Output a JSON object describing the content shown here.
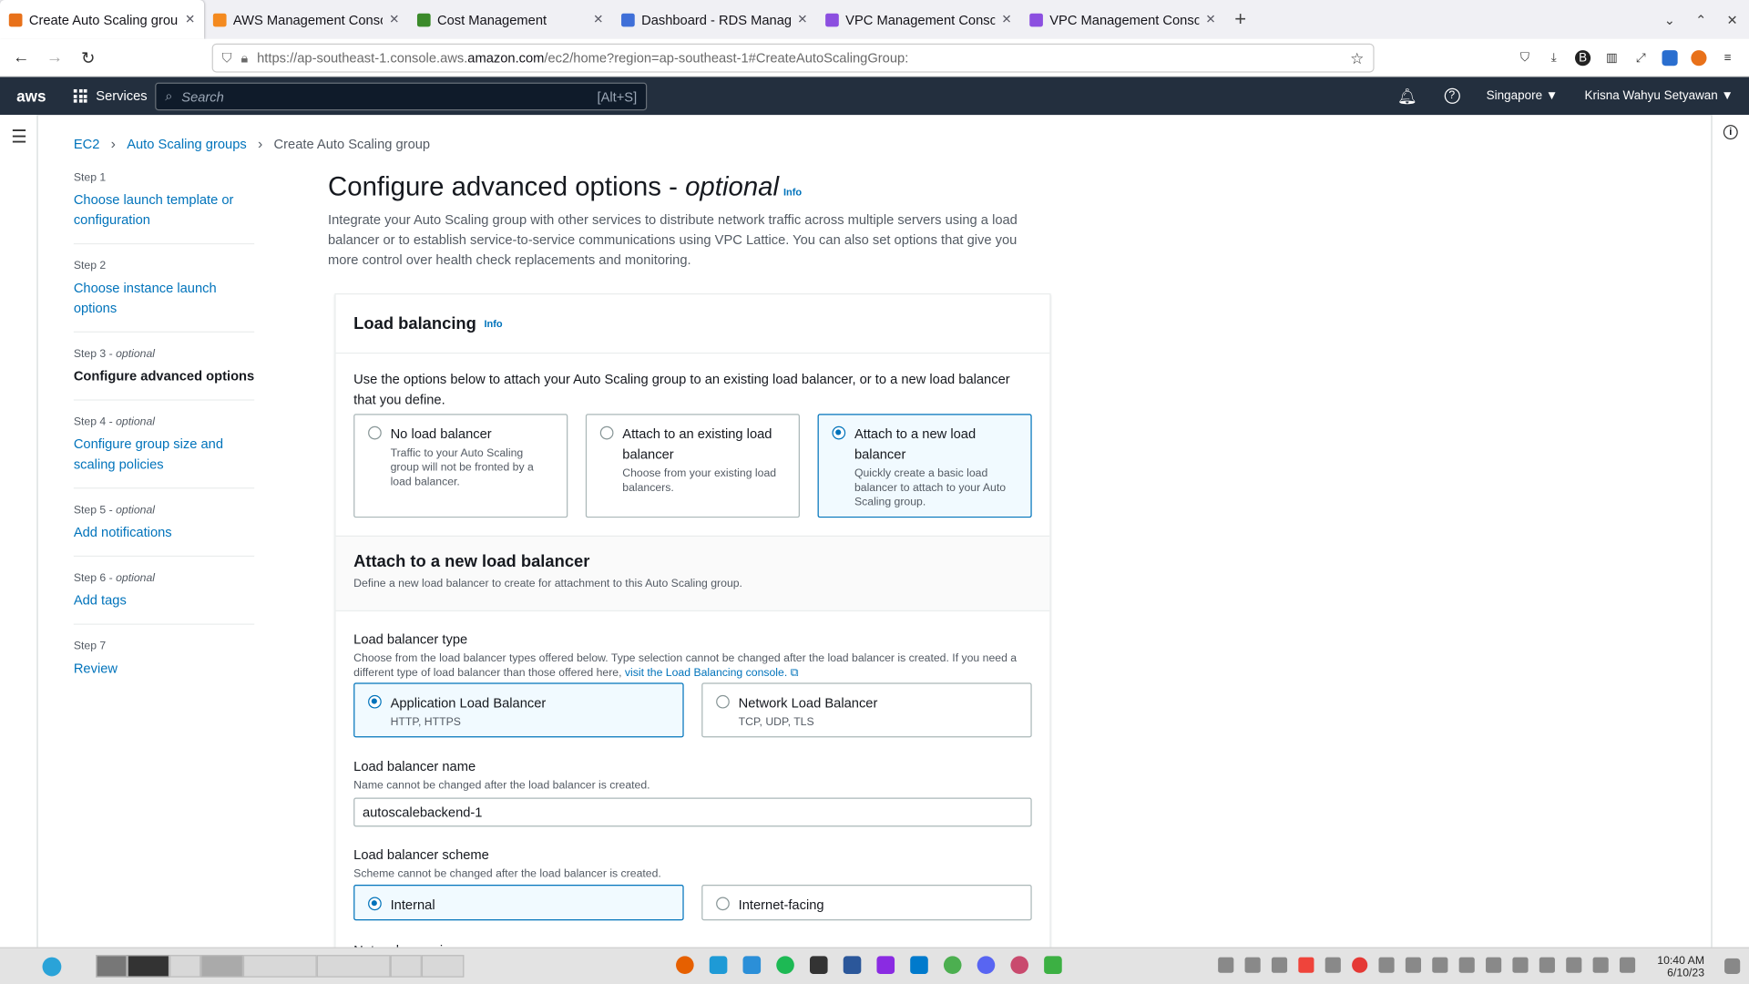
{
  "browser": {
    "tabs": [
      {
        "title": "Create Auto Scaling group | E",
        "color": "#e8711a"
      },
      {
        "title": "AWS Management Console",
        "color": "#f48a1f"
      },
      {
        "title": "Cost Management",
        "color": "#3b8a2a"
      },
      {
        "title": "Dashboard - RDS Managem",
        "color": "#3f6fd8"
      },
      {
        "title": "VPC Management Console",
        "color": "#8c4fe0"
      },
      {
        "title": "VPC Management Console",
        "color": "#8c4fe0"
      }
    ],
    "url_prefix": "https://ap-southeast-1.console.aws.",
    "url_domain": "amazon.com",
    "url_suffix": "/ec2/home?region=ap-southeast-1#CreateAutoScalingGroup:"
  },
  "header": {
    "logo": "aws",
    "services": "Services",
    "search_placeholder": "Search",
    "search_shortcut": "[Alt+S]",
    "region": "Singapore ▼",
    "user": "Krisna Wahyu Setyawan ▼"
  },
  "breadcrumb": {
    "ec2": "EC2",
    "asg": "Auto Scaling groups",
    "current": "Create Auto Scaling group"
  },
  "steps": [
    {
      "num": "Step 1",
      "opt": "",
      "label": "Choose launch template or configuration"
    },
    {
      "num": "Step 2",
      "opt": "",
      "label": "Choose instance launch options"
    },
    {
      "num": "Step 3 - ",
      "opt": "optional",
      "label": "Configure advanced options"
    },
    {
      "num": "Step 4 - ",
      "opt": "optional",
      "label": "Configure group size and scaling policies"
    },
    {
      "num": "Step 5 - ",
      "opt": "optional",
      "label": "Add notifications"
    },
    {
      "num": "Step 6 - ",
      "opt": "optional",
      "label": "Add tags"
    },
    {
      "num": "Step 7",
      "opt": "",
      "label": "Review"
    }
  ],
  "page": {
    "title": "Configure advanced options - ",
    "title_opt": "optional",
    "info": "Info",
    "description": "Integrate your Auto Scaling group with other services to distribute network traffic across multiple servers using a load balancer or to establish service-to-service communications using VPC Lattice. You can also set options that give you more control over health check replacements and monitoring."
  },
  "load_balancing": {
    "title": "Load balancing",
    "info": "Info",
    "intro": "Use the options below to attach your Auto Scaling group to an existing load balancer, or to a new load balancer that you define.",
    "options": [
      {
        "label": "No load balancer",
        "desc": "Traffic to your Auto Scaling group will not be fronted by a load balancer."
      },
      {
        "label": "Attach to an existing load balancer",
        "desc": "Choose from your existing load balancers."
      },
      {
        "label": "Attach to a new load balancer",
        "desc": "Quickly create a basic load balancer to attach to your Auto Scaling group."
      }
    ]
  },
  "new_lb": {
    "title": "Attach to a new load balancer",
    "desc": "Define a new load balancer to create for attachment to this Auto Scaling group.",
    "type_label": "Load balancer type",
    "type_desc": "Choose from the load balancer types offered below. Type selection cannot be changed after the load balancer is created. If you need a different type of load balancer than those offered here,",
    "type_link": "visit the Load Balancing console.",
    "types": [
      {
        "label": "Application Load Balancer",
        "desc": "HTTP, HTTPS"
      },
      {
        "label": "Network Load Balancer",
        "desc": "TCP, UDP, TLS"
      }
    ],
    "name_label": "Load balancer name",
    "name_desc": "Name cannot be changed after the load balancer is created.",
    "name_value": "autoscalebackend-1",
    "scheme_label": "Load balancer scheme",
    "scheme_desc": "Scheme cannot be changed after the load balancer is created.",
    "schemes": [
      "Internal",
      "Internet-facing"
    ],
    "network_label": "Network mapping"
  },
  "taskbar": {
    "time": "10:40 AM",
    "date": "6/10/23"
  }
}
